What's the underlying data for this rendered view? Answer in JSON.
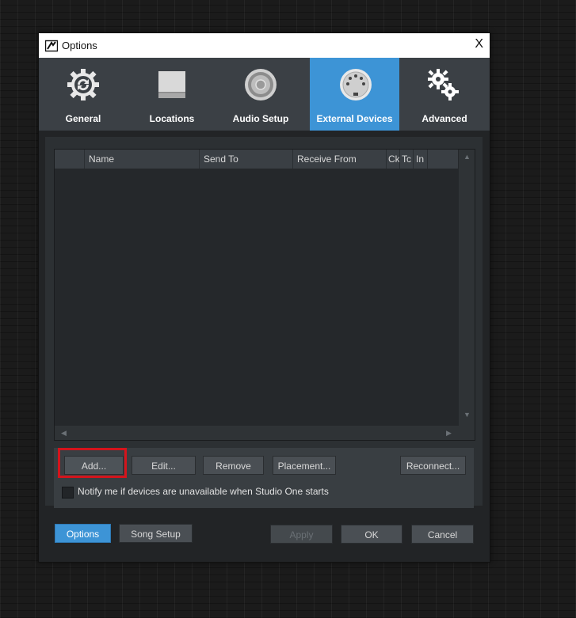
{
  "window": {
    "title": "Options",
    "close_label": "X"
  },
  "tabs": [
    {
      "label": "General",
      "icon": "gear-cycle-icon",
      "active": false
    },
    {
      "label": "Locations",
      "icon": "hard-drive-icon",
      "active": false
    },
    {
      "label": "Audio Setup",
      "icon": "speaker-icon",
      "active": false
    },
    {
      "label": "External Devices",
      "icon": "midi-port-icon",
      "active": true
    },
    {
      "label": "Advanced",
      "icon": "gears-icon",
      "active": false
    }
  ],
  "device_list": {
    "columns": [
      "Name",
      "Send To",
      "Receive From",
      "Ck",
      "Tc",
      "In"
    ],
    "rows": []
  },
  "device_buttons": {
    "add": "Add...",
    "edit": "Edit...",
    "remove": "Remove",
    "placement": "Placement...",
    "reconnect": "Reconnect..."
  },
  "notify_checkbox": {
    "label": "Notify me if devices are unavailable when Studio One starts",
    "checked": false
  },
  "footer": {
    "options": "Options",
    "song_setup": "Song Setup",
    "apply": "Apply",
    "ok": "OK",
    "cancel": "Cancel"
  },
  "colors": {
    "accent": "#3d94d6",
    "highlight": "#d4141c"
  }
}
